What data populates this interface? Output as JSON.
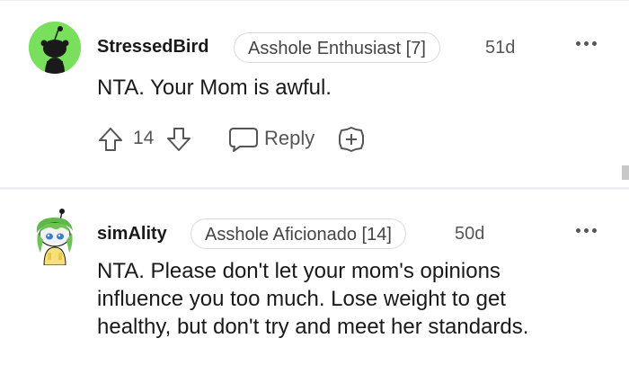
{
  "comments": [
    {
      "username": "StressedBird",
      "flair": "Asshole Enthusiast [7]",
      "age": "51d",
      "body": "NTA. Your Mom is awful.",
      "score": "14",
      "reply_label": "Reply"
    },
    {
      "username": "simAlity",
      "flair": "Asshole Aficionado [14]",
      "age": "50d",
      "body": "NTA. Please don't let your mom's opinions\ninfluence you too much. Lose weight to get\nhealthy, but don't try and meet her standards."
    }
  ],
  "icons": {
    "upvote": "upvote-arrow-icon",
    "downvote": "downvote-arrow-icon",
    "reply": "speech-bubble-icon",
    "award": "plus-badge-icon",
    "more": "more-dots-icon"
  },
  "colors": {
    "avatar_green": "#78e05a",
    "flair_border": "#d7dadc",
    "meta_gray": "#555555"
  }
}
